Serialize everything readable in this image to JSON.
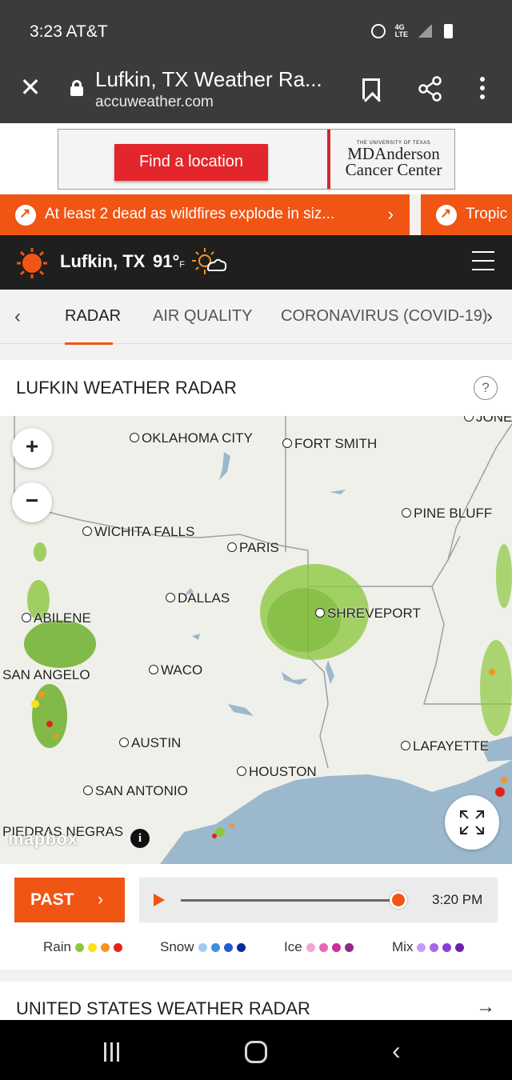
{
  "status_bar": {
    "time": "3:23 AT&T",
    "network": "4G LTE"
  },
  "url_bar": {
    "title": "Lufkin, TX Weather Ra...",
    "domain": "accuweather.com"
  },
  "ad": {
    "button_label": "Find a location",
    "logo_small": "THE UNIVERSITY OF TEXAS",
    "logo_line1": "MDAnderson",
    "logo_line2": "Cancer Center"
  },
  "ticker": {
    "items": [
      {
        "text": "At least 2 dead as wildfires explode in siz..."
      },
      {
        "text": "Tropic"
      }
    ]
  },
  "location": {
    "name": "Lufkin, TX",
    "temp": "91°",
    "unit": "F"
  },
  "nav": {
    "tabs": [
      "RADAR",
      "AIR QUALITY",
      "CORONAVIRUS (COVID-19)"
    ],
    "active": "RADAR"
  },
  "radar": {
    "title": "LUFKIN WEATHER RADAR",
    "help": "?",
    "zoom_in": "+",
    "zoom_out": "−",
    "attribution": "mapbox",
    "info": "i",
    "cities": [
      "OKLAHOMA CITY",
      "FORT SMITH",
      "PINE BLUFF",
      "WICHITA FALLS",
      "PARIS",
      "DALLAS",
      "SHREVEPORT",
      "ABILENE",
      "SAN ANGELO",
      "WACO",
      "AUSTIN",
      "HOUSTON",
      "LAFAYETTE",
      "SAN ANTONIO",
      "PIEDRAS NEGRAS",
      "JONES"
    ]
  },
  "controls": {
    "past_label": "PAST",
    "past_chevron": "›",
    "time": "3:20 PM",
    "timeline_progress": 0.97,
    "legend": [
      {
        "label": "Rain",
        "colors": [
          "#8dc63f",
          "#f7e21b",
          "#f7941d",
          "#e2231a"
        ]
      },
      {
        "label": "Snow",
        "colors": [
          "#9fcbf2",
          "#3c8ee6",
          "#1f5ad0",
          "#0b2b9c"
        ]
      },
      {
        "label": "Ice",
        "colors": [
          "#f2a6cf",
          "#e767b4",
          "#c92f94",
          "#8e2a82"
        ]
      },
      {
        "label": "Mix",
        "colors": [
          "#c79cf0",
          "#a66ae6",
          "#8a3fd8",
          "#6a22b0"
        ]
      }
    ]
  },
  "us_radar": {
    "title": "UNITED STATES WEATHER RADAR",
    "arrow": "→"
  },
  "colors": {
    "accent": "#f05514",
    "header_bg": "#1f1f1f",
    "water": "#9cb8cc"
  }
}
